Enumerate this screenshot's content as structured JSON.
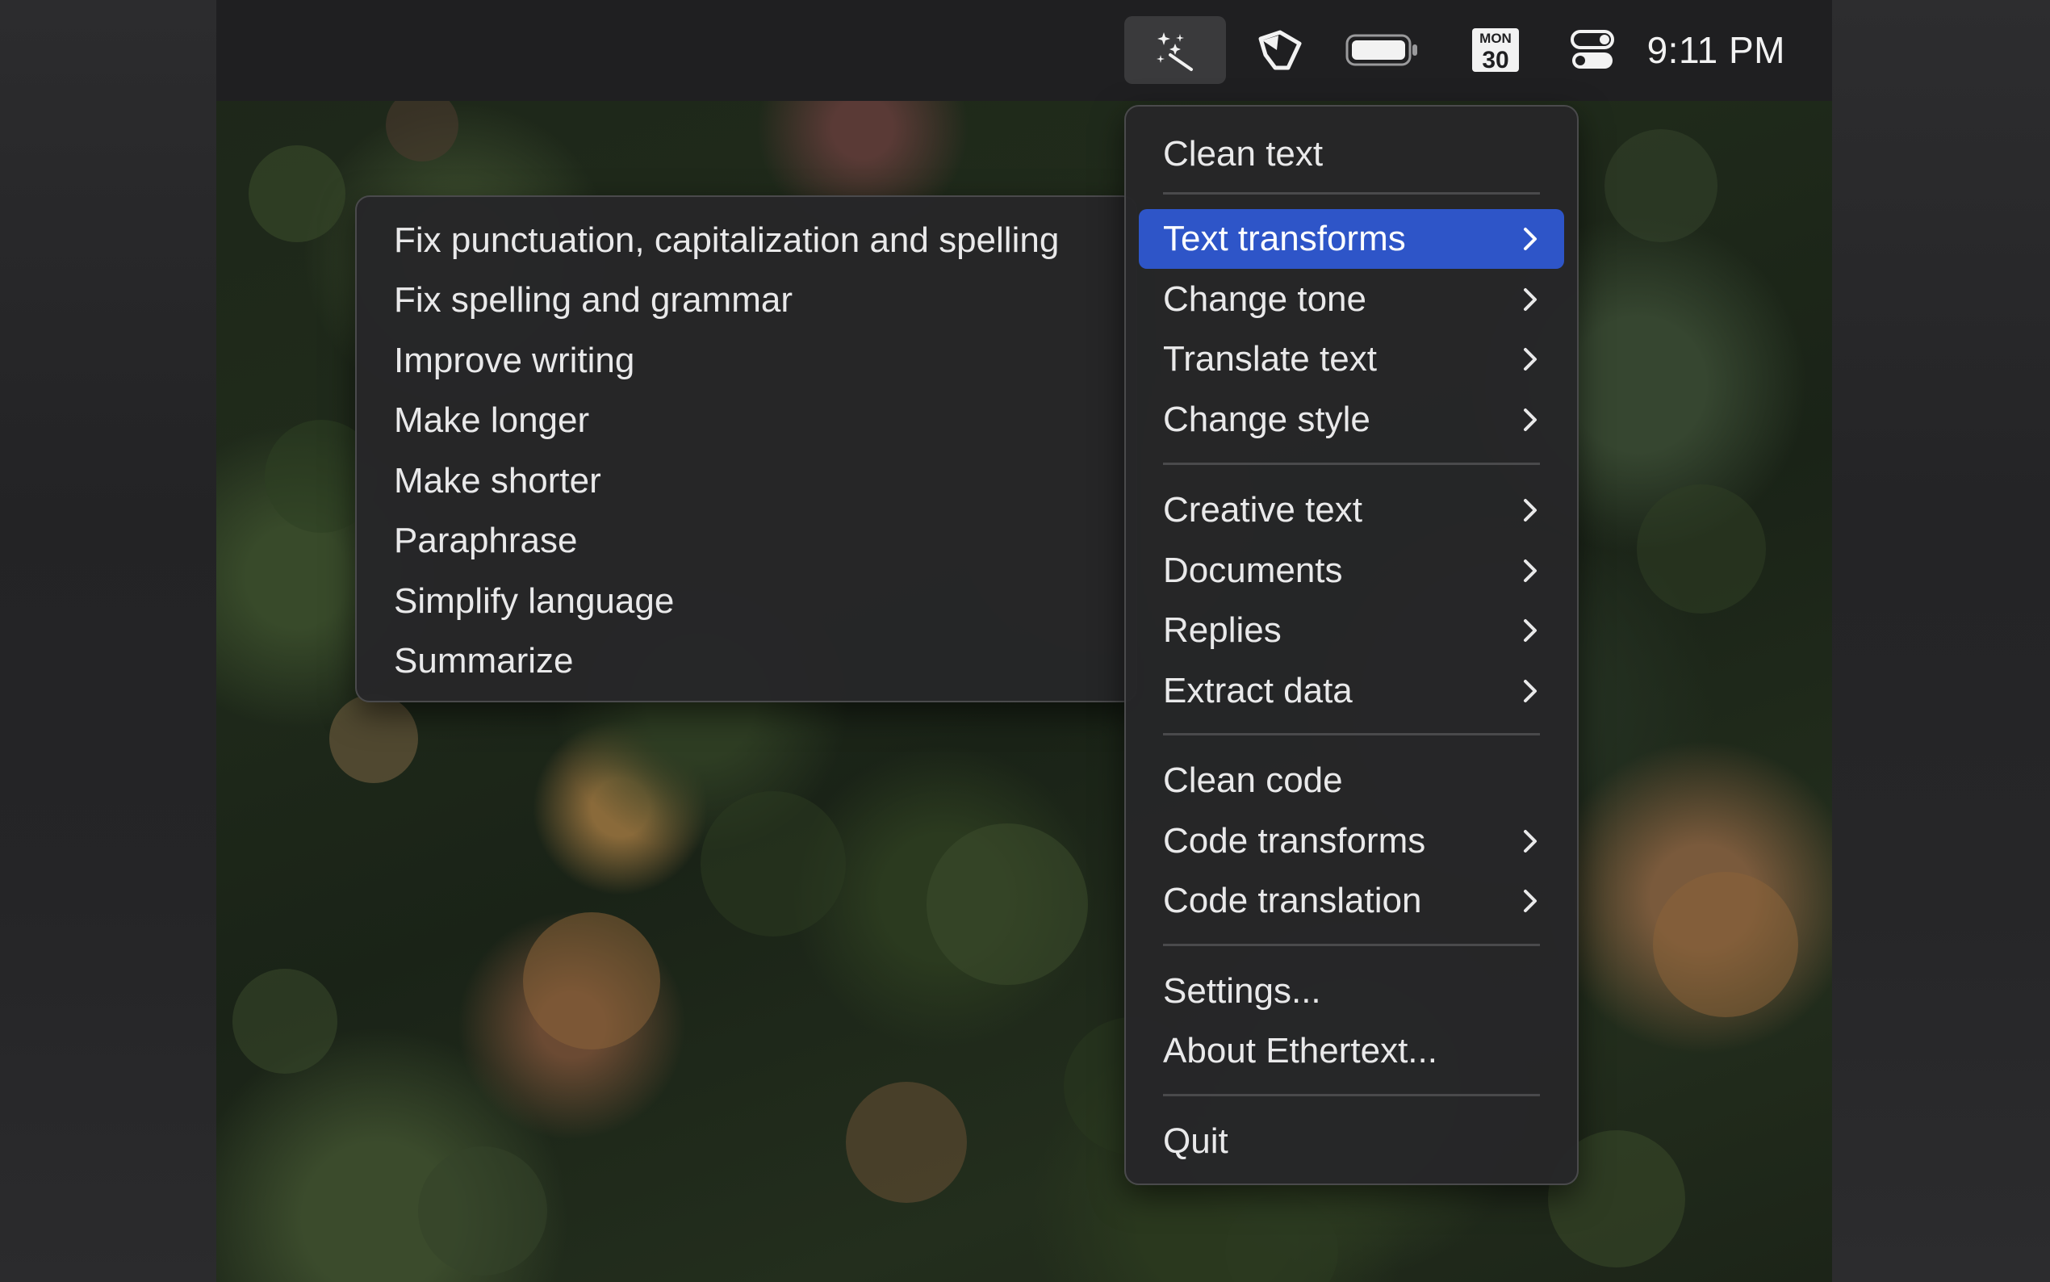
{
  "menubar": {
    "icons": [
      {
        "name": "magic-wand-icon"
      },
      {
        "name": "hand-cursor-icon"
      },
      {
        "name": "battery-icon"
      },
      {
        "name": "calendar-icon",
        "day": "MON",
        "date": "30"
      },
      {
        "name": "control-center-icon"
      }
    ],
    "clock": "9:11 PM"
  },
  "main_menu": {
    "items": [
      {
        "label": "Clean text",
        "submenu": false
      },
      {
        "label": "Text transforms",
        "submenu": true,
        "highlighted": true
      },
      {
        "label": "Change tone",
        "submenu": true
      },
      {
        "label": "Translate text",
        "submenu": true
      },
      {
        "label": "Change style",
        "submenu": true
      },
      {
        "label": "Creative text",
        "submenu": true
      },
      {
        "label": "Documents",
        "submenu": true
      },
      {
        "label": "Replies",
        "submenu": true
      },
      {
        "label": "Extract data",
        "submenu": true
      },
      {
        "label": "Clean code",
        "submenu": false
      },
      {
        "label": "Code transforms",
        "submenu": true
      },
      {
        "label": "Code translation",
        "submenu": true
      },
      {
        "label": "Settings...",
        "submenu": false
      },
      {
        "label": "About Ethertext...",
        "submenu": false
      },
      {
        "label": "Quit",
        "submenu": false
      }
    ]
  },
  "submenu": {
    "items": [
      "Fix punctuation, capitalization and spelling",
      "Fix spelling and grammar",
      "Improve writing",
      "Make longer",
      "Make shorter",
      "Paraphrase",
      "Simplify language",
      "Summarize"
    ]
  },
  "colors": {
    "highlight": "#2e55c8",
    "menu_bg": "#262628",
    "menubar_bg": "#1f1f21",
    "text": "#e9e9ea"
  }
}
